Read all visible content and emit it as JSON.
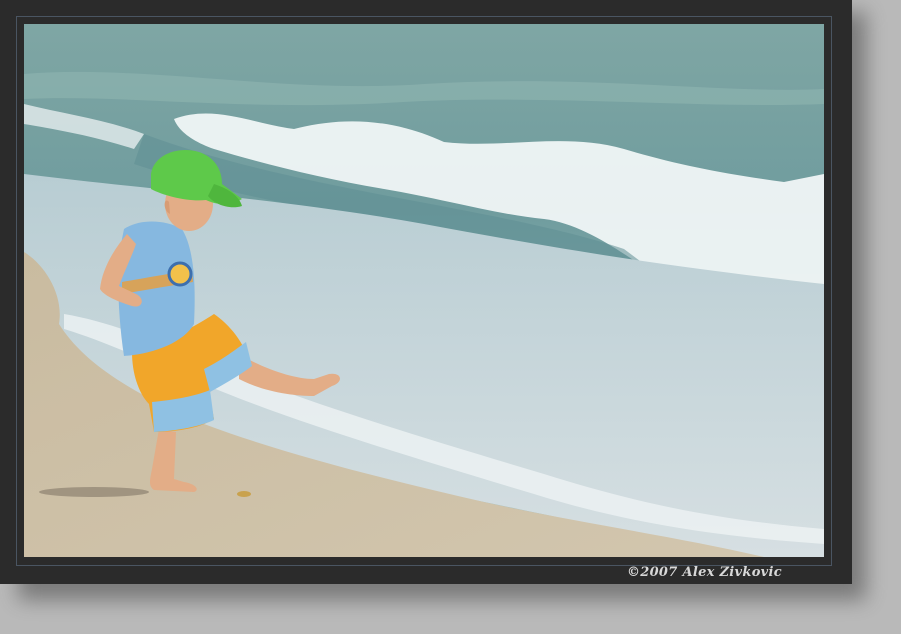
{
  "watermark": {
    "text": "©2007 Alex Zivkovic"
  },
  "colors": {
    "page_bg": "#b9b9b9",
    "frame": "#2b2b2b",
    "frame_line": "#4a5562",
    "sea_deep": "#6f9c9e",
    "sea_light": "#a9c6c8",
    "foam": "#f4f8f8",
    "sand": "#cbbfa6",
    "cap": "#5ec94a",
    "shirt": "#86b8e0",
    "shorts": "#f1a62a",
    "skin": "#e9b48f"
  }
}
